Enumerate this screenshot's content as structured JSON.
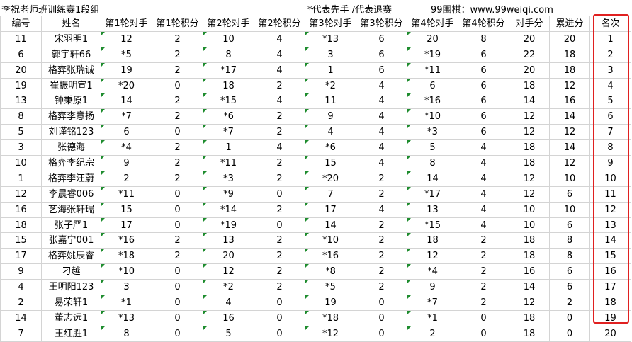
{
  "title": {
    "main": "李祝老师班训练赛1段组",
    "note": "*代表先手  /代表退赛",
    "site": "99围棋：www.99weiqi.com"
  },
  "table": {
    "headers": [
      "编号",
      "姓名",
      "第1轮对手",
      "第1轮积分",
      "第2轮对手",
      "第2轮积分",
      "第3轮对手",
      "第3轮积分",
      "第4轮对手",
      "第4轮积分",
      "对手分",
      "累进分",
      "名次"
    ],
    "rows": [
      [
        "11",
        "宋羽明1",
        "12",
        "2",
        "10",
        "4",
        "*13",
        "6",
        "20",
        "8",
        "20",
        "20",
        "1"
      ],
      [
        "6",
        "郭宇轩66",
        "*5",
        "2",
        "8",
        "4",
        "3",
        "6",
        "*19",
        "6",
        "22",
        "18",
        "2"
      ],
      [
        "20",
        "格弈张瑞诚",
        "19",
        "2",
        "*17",
        "4",
        "1",
        "6",
        "*11",
        "6",
        "20",
        "18",
        "3"
      ],
      [
        "19",
        "崔振明宣1",
        "*20",
        "0",
        "18",
        "2",
        "*2",
        "4",
        "6",
        "6",
        "18",
        "12",
        "4"
      ],
      [
        "13",
        "钟秉原1",
        "14",
        "2",
        "*15",
        "4",
        "11",
        "4",
        "*16",
        "6",
        "14",
        "16",
        "5"
      ],
      [
        "8",
        "格弈李意扬",
        "*7",
        "2",
        "*6",
        "2",
        "9",
        "4",
        "*10",
        "6",
        "12",
        "14",
        "6"
      ],
      [
        "5",
        "刘谨铭123",
        "6",
        "0",
        "*7",
        "2",
        "4",
        "4",
        "*3",
        "6",
        "12",
        "12",
        "7"
      ],
      [
        "3",
        "张德海",
        "*4",
        "2",
        "1",
        "4",
        "*6",
        "4",
        "5",
        "4",
        "18",
        "14",
        "8"
      ],
      [
        "10",
        "格弈李纪宗",
        "9",
        "2",
        "*11",
        "2",
        "15",
        "4",
        "8",
        "4",
        "18",
        "12",
        "9"
      ],
      [
        "1",
        "格弈李汪蔚",
        "2",
        "2",
        "*3",
        "2",
        "*20",
        "2",
        "14",
        "4",
        "12",
        "10",
        "10"
      ],
      [
        "12",
        "李晨睿006",
        "*11",
        "0",
        "*9",
        "0",
        "7",
        "2",
        "*17",
        "4",
        "12",
        "6",
        "11"
      ],
      [
        "16",
        "艺海张轩瑞",
        "15",
        "0",
        "*14",
        "2",
        "17",
        "4",
        "13",
        "4",
        "10",
        "10",
        "12"
      ],
      [
        "18",
        "张子严1",
        "17",
        "0",
        "*19",
        "0",
        "14",
        "2",
        "*15",
        "4",
        "10",
        "6",
        "13"
      ],
      [
        "15",
        "张嘉宁001",
        "*16",
        "2",
        "13",
        "2",
        "*10",
        "2",
        "18",
        "2",
        "18",
        "8",
        "14"
      ],
      [
        "17",
        "格弈姚辰睿",
        "*18",
        "2",
        "20",
        "2",
        "*16",
        "2",
        "12",
        "2",
        "18",
        "8",
        "15"
      ],
      [
        "9",
        "刁越",
        "*10",
        "0",
        "12",
        "2",
        "*8",
        "2",
        "*4",
        "2",
        "16",
        "6",
        "16"
      ],
      [
        "4",
        "王明阳123",
        "3",
        "0",
        "*2",
        "2",
        "*5",
        "2",
        "9",
        "2",
        "14",
        "6",
        "17"
      ],
      [
        "2",
        "易荣轩1",
        "*1",
        "0",
        "4",
        "0",
        "19",
        "0",
        "*7",
        "2",
        "12",
        "2",
        "18"
      ],
      [
        "14",
        "董志远1",
        "*13",
        "0",
        "16",
        "0",
        "*18",
        "0",
        "*1",
        "0",
        "18",
        "0",
        "19"
      ],
      [
        "7",
        "王红胜1",
        "8",
        "0",
        "5",
        "0",
        "*12",
        "0",
        "2",
        "0",
        "18",
        "0",
        "20"
      ]
    ]
  },
  "colors": {
    "grid": "#d4d4d4",
    "flag": "#1e8c2e",
    "highlight_box": "#e02020"
  }
}
